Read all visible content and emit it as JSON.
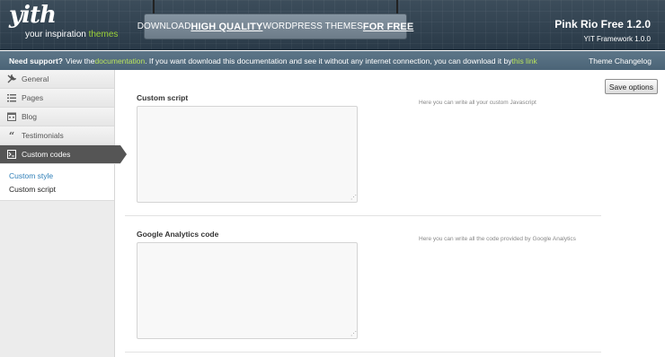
{
  "header": {
    "logo_mark": "yith",
    "logo_tag_before": "your inspiration ",
    "logo_tag_highlight": "themes",
    "banner": {
      "pre": "DOWNLOAD ",
      "strong1": "HIGH QUALITY",
      "mid": " WORDPRESS THEMES ",
      "strong2": "FOR FREE"
    },
    "theme_name": "Pink Rio Free 1.2.0",
    "framework_version": "YIT Framework 1.0.0"
  },
  "support_bar": {
    "label": "Need support?",
    "text_before": " View the ",
    "doc_link": "documentation",
    "text_after": ". If you want download this documentation and see it without any internet connection, you can download it by ",
    "download_link": "this link",
    "changelog": "Theme Changelog"
  },
  "sidebar": {
    "items": [
      {
        "label": "General",
        "icon": "wrench-icon"
      },
      {
        "label": "Pages",
        "icon": "list-icon"
      },
      {
        "label": "Blog",
        "icon": "calendar-icon"
      },
      {
        "label": "Testimonials",
        "icon": "quote-icon"
      },
      {
        "label": "Custom codes",
        "icon": "terminal-icon"
      }
    ],
    "submenu": [
      {
        "label": "Custom style"
      },
      {
        "label": "Custom script"
      }
    ]
  },
  "main": {
    "save_button": "Save options",
    "fields": [
      {
        "label": "Custom script",
        "description": "Here you can write all your custom Javascript",
        "value": ""
      },
      {
        "label": "Google Analytics code",
        "description": "Here you can write all the code provided by Google Analytics",
        "value": ""
      }
    ]
  }
}
